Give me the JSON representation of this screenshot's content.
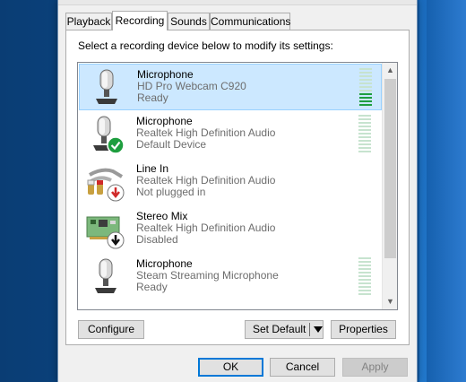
{
  "tabs": [
    {
      "label": "Playback"
    },
    {
      "label": "Recording"
    },
    {
      "label": "Sounds"
    },
    {
      "label": "Communications"
    }
  ],
  "active_tab": "Recording",
  "instruction": "Select a recording device below to modify its settings:",
  "devices": [
    {
      "name": "Microphone",
      "device": "HD Pro Webcam C920",
      "status": "Ready",
      "icon": "microphone-icon",
      "selected": true,
      "level_bars": 3
    },
    {
      "name": "Microphone",
      "device": "Realtek High Definition Audio",
      "status": "Default Device",
      "icon": "microphone-default-icon",
      "badge": "green-check",
      "level_bars": 0
    },
    {
      "name": "Line In",
      "device": "Realtek High Definition Audio",
      "status": "Not plugged in",
      "icon": "line-in-icon",
      "badge": "red-down-arrow"
    },
    {
      "name": "Stereo Mix",
      "device": "Realtek High Definition Audio",
      "status": "Disabled",
      "icon": "stereo-mix-icon",
      "badge": "black-down-arrow"
    },
    {
      "name": "Microphone",
      "device": "Steam Streaming Microphone",
      "status": "Ready",
      "icon": "microphone-icon",
      "level_bars": 0
    }
  ],
  "buttons": {
    "configure": "Configure",
    "set_default": "Set Default",
    "properties": "Properties",
    "ok": "OK",
    "cancel": "Cancel",
    "apply": "Apply"
  },
  "colors": {
    "selection": "#cce8ff",
    "level_active": "#1e9e3f",
    "level_idle": "#c7e3cf",
    "default_badge": "#1e9e3f"
  }
}
